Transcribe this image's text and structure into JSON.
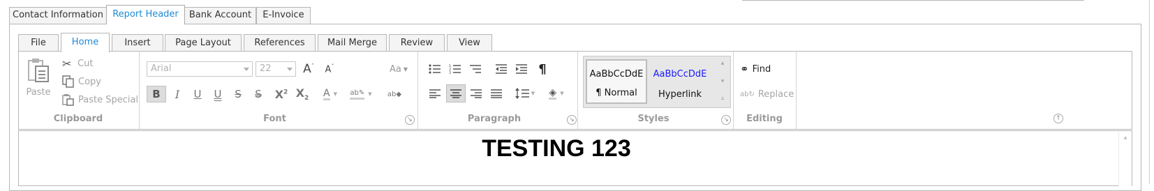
{
  "outer_tabs": [
    "Contact Information",
    "Report Header",
    "Bank Account",
    "E-Invoice"
  ],
  "ribbon_tabs": [
    "File",
    "Home",
    "Insert",
    "Page Layout",
    "References",
    "Mail Merge",
    "Review",
    "View"
  ],
  "clipboard": {
    "paste": "Paste",
    "cut": "Cut",
    "copy": "Copy",
    "paste_special": "Paste Special",
    "label": "Clipboard"
  },
  "font": {
    "family": "Arial",
    "size": "22",
    "change_case": "Aa",
    "label": "Font"
  },
  "paragraph": {
    "label": "Paragraph"
  },
  "styles": {
    "normal_preview": "AaBbCcDdE",
    "normal_name": "¶ Normal",
    "hyperlink_preview": "AaBbCcDdE",
    "hyperlink_name": "Hyperlink",
    "label": "Styles"
  },
  "editing": {
    "find": "Find",
    "replace": "Replace",
    "label": "Editing"
  },
  "document": {
    "text": "TESTING 123"
  },
  "colors": {
    "accent": "#1e8bd6",
    "hyperlink": "#1a1aff",
    "disabled": "#a5a5a5"
  }
}
